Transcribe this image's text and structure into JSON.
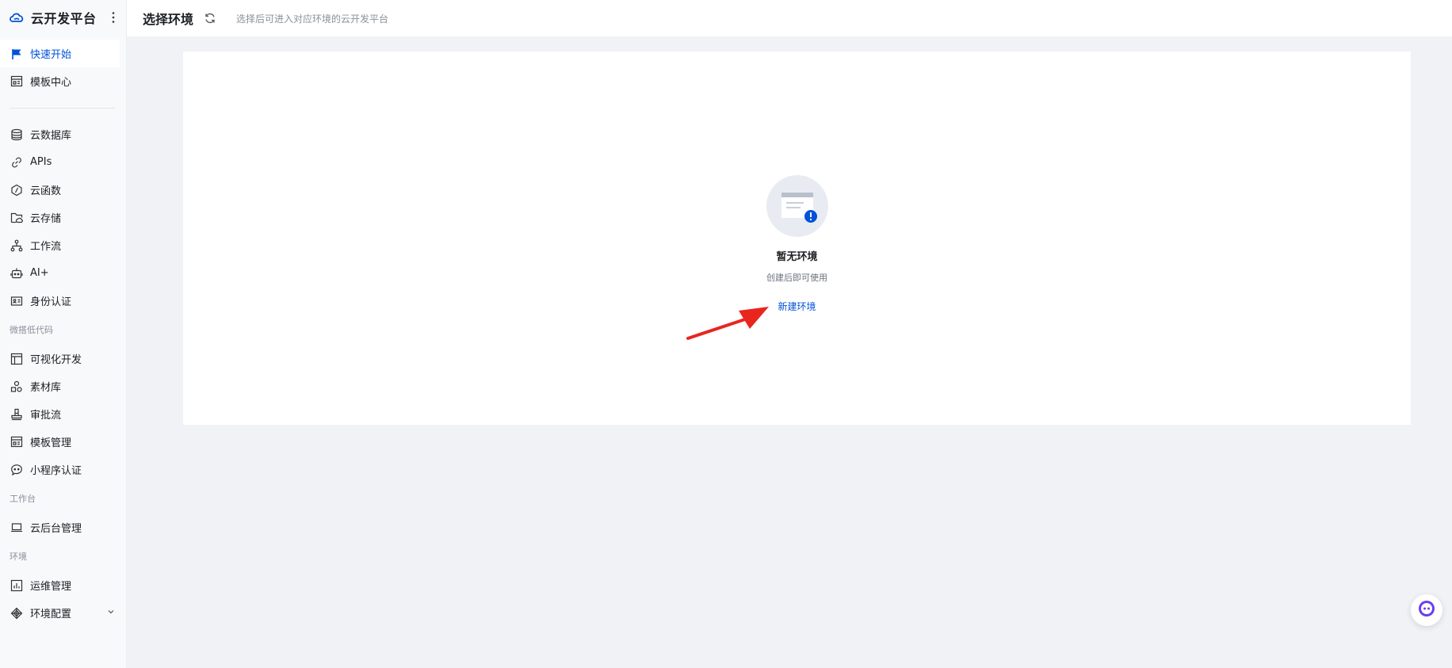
{
  "brand": {
    "name": "云开发平台",
    "logo_icon": "cloud-icon",
    "more_icon": "more-vertical-icon"
  },
  "sidebar": {
    "top_items": [
      {
        "label": "快速开始",
        "icon": "flag-icon",
        "active": true
      },
      {
        "label": "模板中心",
        "icon": "template-icon",
        "active": false
      }
    ],
    "main_items": [
      {
        "label": "云数据库",
        "icon": "database-icon"
      },
      {
        "label": "APIs",
        "icon": "link-icon"
      },
      {
        "label": "云函数",
        "icon": "function-icon"
      },
      {
        "label": "云存储",
        "icon": "storage-icon"
      },
      {
        "label": "工作流",
        "icon": "workflow-icon"
      },
      {
        "label": "AI+",
        "icon": "robot-icon"
      },
      {
        "label": "身份认证",
        "icon": "id-card-icon"
      }
    ],
    "group_lowcode": "微搭低代码",
    "lowcode_items": [
      {
        "label": "可视化开发",
        "icon": "layout-icon"
      },
      {
        "label": "素材库",
        "icon": "shapes-icon"
      },
      {
        "label": "审批流",
        "icon": "stamp-icon"
      },
      {
        "label": "模板管理",
        "icon": "template-manage-icon"
      },
      {
        "label": "小程序认证",
        "icon": "chat-bubble-icon"
      }
    ],
    "group_workbench": "工作台",
    "workbench_items": [
      {
        "label": "云后台管理",
        "icon": "laptop-icon"
      }
    ],
    "group_env": "环境",
    "env_items": [
      {
        "label": "运维管理",
        "icon": "chart-icon"
      },
      {
        "label": "环境配置",
        "icon": "config-icon",
        "expandable": true
      }
    ]
  },
  "header": {
    "title": "选择环境",
    "subtitle": "选择后可进入对应环境的云开发平台",
    "refresh_icon": "refresh-icon"
  },
  "empty_state": {
    "icon": "empty-doc-icon",
    "title": "暂无环境",
    "description": "创建后即可使用",
    "action_label": "新建环境"
  },
  "colors": {
    "accent": "#0052d9",
    "annotation": "#e8261f"
  },
  "assistant_icon": "assistant-robot-icon"
}
